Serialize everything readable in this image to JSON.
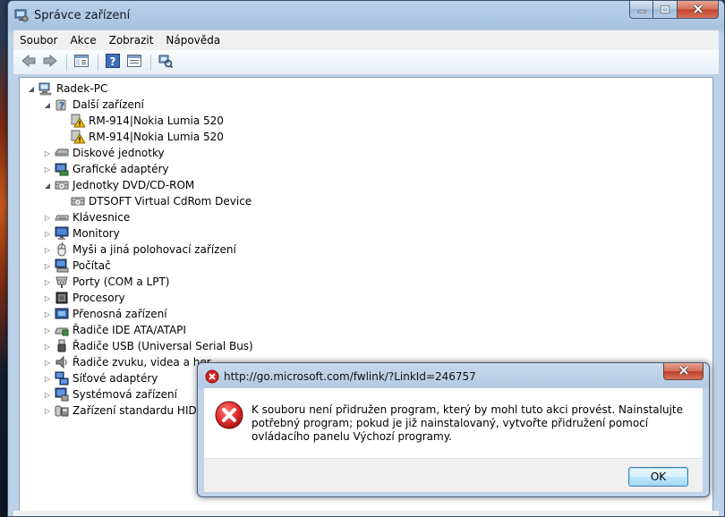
{
  "window": {
    "title": "Správce zařízení",
    "caption_buttons": {
      "minimize": "minimize-icon",
      "maximize": "maximize-icon",
      "close": "close-icon"
    }
  },
  "menu": [
    "Soubor",
    "Akce",
    "Zobrazit",
    "Nápověda"
  ],
  "toolbar": [
    "back-arrow-icon",
    "forward-arrow-icon",
    "show-hide-console-tree-icon",
    "help-icon",
    "properties-icon",
    "scan-hardware-icon"
  ],
  "tree": [
    {
      "label": "Radek-PC",
      "icon": "computer-icon",
      "expanded": true
    },
    {
      "label": "Další zařízení",
      "icon": "unknown-device-icon",
      "expanded": true
    },
    {
      "label": "RM-914|Nokia Lumia 520",
      "icon": "warning-device-icon"
    },
    {
      "label": "RM-914|Nokia Lumia 520",
      "icon": "warning-device-icon"
    },
    {
      "label": "Diskové jednotky",
      "icon": "disk-drive-icon",
      "expanded": false
    },
    {
      "label": "Grafické adaptéry",
      "icon": "display-adapter-icon",
      "expanded": false
    },
    {
      "label": "Jednotky DVD/CD-ROM",
      "icon": "dvd-drive-icon",
      "expanded": true
    },
    {
      "label": "DTSOFT Virtual CdRom Device",
      "icon": "dvd-drive-icon"
    },
    {
      "label": "Klávesnice",
      "icon": "keyboard-icon",
      "expanded": false
    },
    {
      "label": "Monitory",
      "icon": "monitor-icon",
      "expanded": false
    },
    {
      "label": "Myši a jiná polohovací zařízení",
      "icon": "mouse-icon",
      "expanded": false
    },
    {
      "label": "Počítač",
      "icon": "computer-small-icon",
      "expanded": false
    },
    {
      "label": "Porty (COM a LPT)",
      "icon": "port-icon",
      "expanded": false
    },
    {
      "label": "Procesory",
      "icon": "processor-icon",
      "expanded": false
    },
    {
      "label": "Přenosná zařízení",
      "icon": "portable-device-icon",
      "expanded": false
    },
    {
      "label": "Řadiče IDE ATA/ATAPI",
      "icon": "ide-controller-icon",
      "expanded": false
    },
    {
      "label": "Řadiče USB (Universal Serial Bus)",
      "icon": "usb-icon",
      "expanded": false
    },
    {
      "label": "Řadiče zvuku, videa a her",
      "icon": "sound-icon",
      "expanded": false
    },
    {
      "label": "Síťové adaptéry",
      "icon": "network-adapter-icon",
      "expanded": false
    },
    {
      "label": "Systémová zařízení",
      "icon": "system-device-icon",
      "expanded": false
    },
    {
      "label": "Zařízení standardu HID",
      "icon": "hid-icon",
      "expanded": false
    }
  ],
  "dialog": {
    "title": "http://go.microsoft.com/fwlink/?LinkId=246757",
    "message": "K souboru není přidružen program, který by mohl tuto akci provést. Nainstalujte potřebný program; pokud je již nainstalovaný, vytvořte přidružení pomocí ovládacího panelu Výchozí programy.",
    "ok_label": "OK",
    "icon": "error-icon"
  },
  "colors": {
    "error_red": "#d42020",
    "warning_yellow": "#f3c200",
    "title_bar": "#b9d1ea"
  }
}
